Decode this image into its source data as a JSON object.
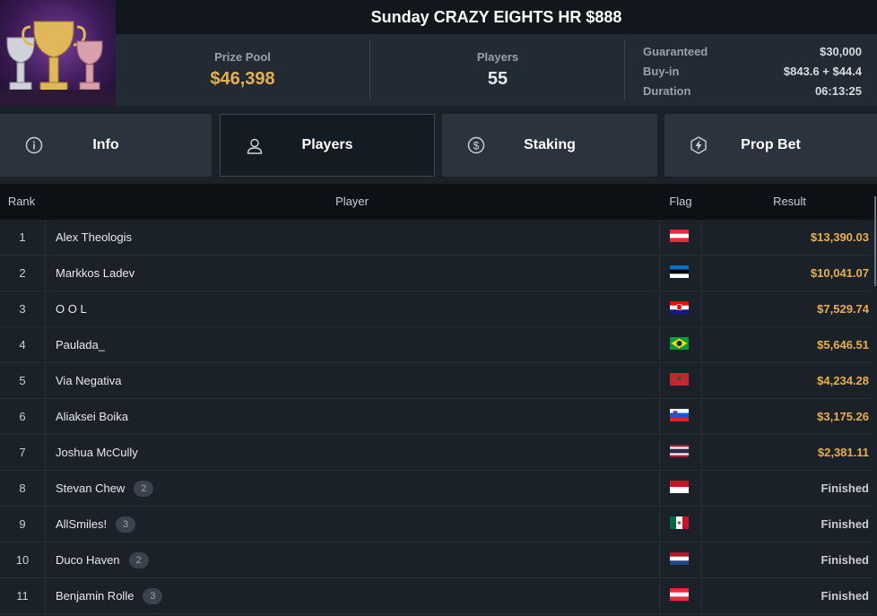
{
  "tournament": {
    "title": "Sunday CRAZY EIGHTS HR $888"
  },
  "stats": {
    "prize_pool_label": "Prize Pool",
    "prize_pool_value": "$46,398",
    "players_label": "Players",
    "players_value": "55"
  },
  "details": [
    {
      "key": "Guaranteed",
      "value": "$30,000"
    },
    {
      "key": "Buy-in",
      "value": "$843.6 + $44.4"
    },
    {
      "key": "Duration",
      "value": "06:13:25"
    }
  ],
  "tabs": [
    {
      "label": "Info",
      "icon": "info-icon",
      "active": false
    },
    {
      "label": "Players",
      "icon": "user-icon",
      "active": true
    },
    {
      "label": "Staking",
      "icon": "dollar-circle-icon",
      "active": false
    },
    {
      "label": "Prop Bet",
      "icon": "lightning-badge-icon",
      "active": false
    }
  ],
  "table": {
    "headers": {
      "rank": "Rank",
      "player": "Player",
      "flag": "Flag",
      "result": "Result"
    },
    "rows": [
      {
        "rank": "1",
        "player": "Alex Theologis",
        "badge": "",
        "flag": "austria",
        "result": "$13,390.03"
      },
      {
        "rank": "2",
        "player": "Markkos Ladev",
        "badge": "",
        "flag": "estonia",
        "result": "$10,041.07"
      },
      {
        "rank": "3",
        "player": "O O L",
        "badge": "",
        "flag": "croatia",
        "result": "$7,529.74"
      },
      {
        "rank": "4",
        "player": "Paulada_",
        "badge": "",
        "flag": "brazil",
        "result": "$5,646.51"
      },
      {
        "rank": "5",
        "player": "Via Negativa",
        "badge": "",
        "flag": "morocco",
        "result": "$4,234.28"
      },
      {
        "rank": "6",
        "player": "Aliaksei Boika",
        "badge": "",
        "flag": "slovenia",
        "result": "$3,175.26"
      },
      {
        "rank": "7",
        "player": "Joshua McCully",
        "badge": "",
        "flag": "thailand",
        "result": "$2,381.11"
      },
      {
        "rank": "8",
        "player": "Stevan Chew",
        "badge": "2",
        "flag": "indonesia",
        "result": "Finished"
      },
      {
        "rank": "9",
        "player": "AllSmiles!",
        "badge": "3",
        "flag": "mexico",
        "result": "Finished"
      },
      {
        "rank": "10",
        "player": "Duco Haven",
        "badge": "2",
        "flag": "netherlands",
        "result": "Finished"
      },
      {
        "rank": "11",
        "player": "Benjamin Rolle",
        "badge": "3",
        "flag": "austria",
        "result": "Finished"
      }
    ]
  },
  "colors": {
    "accent_gold": "#e8b04a",
    "header_bg": "#12171d",
    "tab_bg": "#2b333e",
    "tab_active_bg": "#151b22"
  }
}
